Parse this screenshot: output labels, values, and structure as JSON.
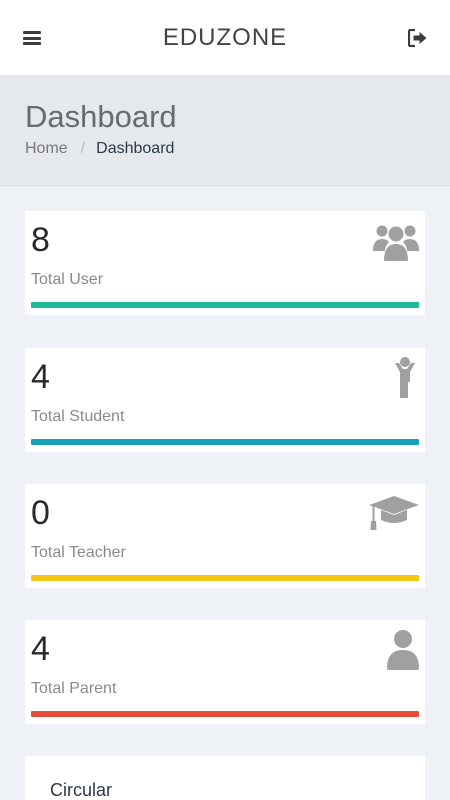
{
  "app": {
    "title": "EDUZONE"
  },
  "header": {
    "menu_icon": "hamburger-menu-icon",
    "logout_icon": "sign-out-icon"
  },
  "page": {
    "title": "Dashboard",
    "breadcrumb": {
      "home": "Home",
      "separator": "/",
      "current": "Dashboard"
    }
  },
  "stats": [
    {
      "value": "8",
      "label": "Total User",
      "icon": "users-group-icon",
      "color": "#1abc9c"
    },
    {
      "value": "4",
      "label": "Total Student",
      "icon": "child-icon",
      "color": "#17a2b8"
    },
    {
      "value": "0",
      "label": "Total Teacher",
      "icon": "graduation-cap-icon",
      "color": "#f5c518"
    },
    {
      "value": "4",
      "label": "Total Parent",
      "icon": "user-icon",
      "color": "#e74c3c"
    }
  ],
  "circular": {
    "title": "Circular"
  },
  "colors": {
    "icon_gray": "#a0a0a0",
    "background": "#eef1f5"
  }
}
